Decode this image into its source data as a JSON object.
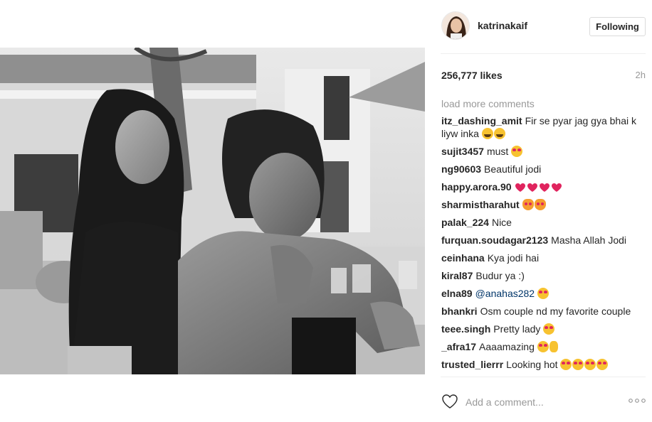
{
  "post": {
    "author": "katrinakaif",
    "follow_label": "Following",
    "likes": "256,777 likes",
    "time": "2h"
  },
  "comments_section": {
    "load_more": "load more comments",
    "items": [
      {
        "user": "itz_dashing_amit",
        "text": "Fir se pyar jag gya bhai k liyw inka",
        "emojis": [
          "laugh",
          "laugh"
        ]
      },
      {
        "user": "sujit3457",
        "text": "must",
        "emojis": [
          "heart-eyes"
        ]
      },
      {
        "user": "ng90603",
        "text": "Beautiful jodi",
        "emojis": []
      },
      {
        "user": "happy.arora.90",
        "text": "",
        "emojis": [
          "heart",
          "heart",
          "heart",
          "heart"
        ]
      },
      {
        "user": "sharmistharahut",
        "text": "",
        "emojis": [
          "cat",
          "cat"
        ]
      },
      {
        "user": "palak_224",
        "text": "Nice",
        "emojis": []
      },
      {
        "user": "furquan.soudagar2123",
        "text": "Masha Allah Jodi",
        "emojis": []
      },
      {
        "user": "ceinhana",
        "text": "Kya jodi hai",
        "emojis": []
      },
      {
        "user": "kiral87",
        "text": "Budur ya :)",
        "emojis": []
      },
      {
        "user": "elna89",
        "text": "@anahas282",
        "mention": true,
        "emojis": [
          "heart-eyes"
        ]
      },
      {
        "user": "bhankri",
        "text": "Osm couple nd my favorite couple",
        "emojis": []
      },
      {
        "user": "teee.singh",
        "text": "Pretty lady",
        "emojis": [
          "heart-eyes"
        ]
      },
      {
        "user": "_afra17",
        "text": "Aaaamazing",
        "emojis": [
          "heart-eyes",
          "ok"
        ]
      },
      {
        "user": "trusted_lierrr",
        "text": "Looking hot",
        "emojis": [
          "heart-eyes",
          "heart-eyes",
          "heart-eyes",
          "heart-eyes"
        ]
      }
    ]
  },
  "composer": {
    "placeholder": "Add a comment..."
  },
  "icons": {
    "like": "heart-outline-icon",
    "more": "more-options-icon"
  },
  "colors": {
    "text": "#262626",
    "muted": "#999999",
    "mention": "#003569",
    "border": "#dbdbdb"
  }
}
